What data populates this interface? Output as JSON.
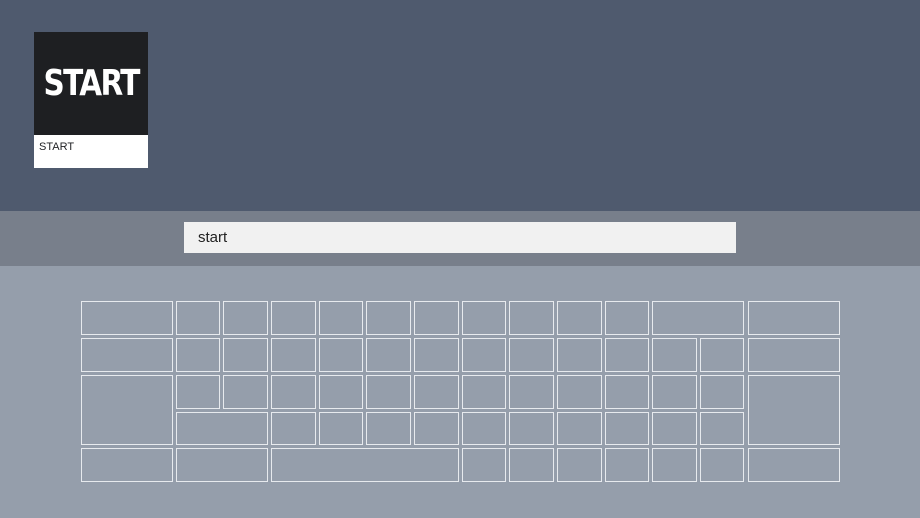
{
  "results": {
    "tiles": [
      {
        "logo_text": "START",
        "caption": "START"
      }
    ]
  },
  "search": {
    "value": "start"
  }
}
